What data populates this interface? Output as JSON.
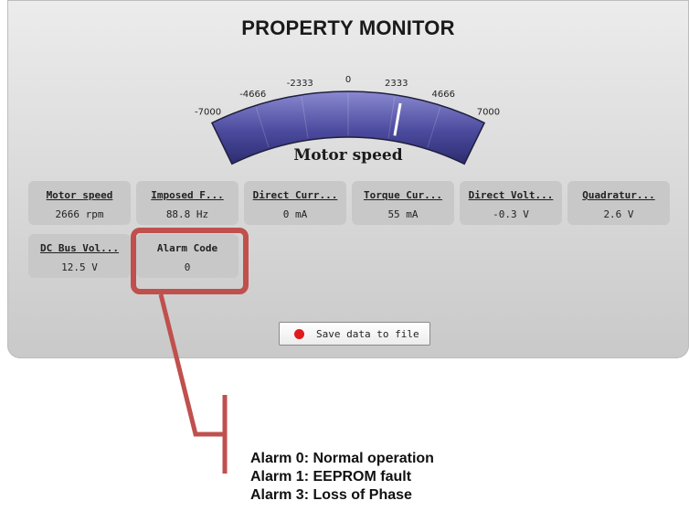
{
  "panel": {
    "title": "PROPERTY MONITOR"
  },
  "gauge": {
    "label": "Motor speed",
    "min": -7000,
    "max": 7000,
    "value": 2666,
    "ticks": [
      "-7000",
      "-4666",
      "-2333",
      "0",
      "2333",
      "4666",
      "7000"
    ],
    "colors": {
      "band": "#4b4a9e",
      "needle": "#ffffff"
    }
  },
  "tiles": [
    {
      "label": "Motor speed",
      "value": "2666 rpm"
    },
    {
      "label": "Imposed F...",
      "value": "88.8 Hz"
    },
    {
      "label": "Direct Curr...",
      "value": "0 mA"
    },
    {
      "label": "Torque Cur...",
      "value": "55 mA"
    },
    {
      "label": "Direct Volt...",
      "value": "-0.3 V"
    },
    {
      "label": "Quadratur...",
      "value": "2.6 V"
    },
    {
      "label": "DC Bus Vol...",
      "value": "12.5 V"
    },
    {
      "label": "Alarm Code",
      "value": "0"
    }
  ],
  "save_button": {
    "label": "Save data to file",
    "icon": "record-icon",
    "icon_color": "#e0191c"
  },
  "annotation": {
    "color": "#c0504d",
    "lines": [
      "Alarm 0: Normal operation",
      "Alarm 1: EEPROM fault",
      "Alarm 3: Loss of Phase"
    ]
  }
}
